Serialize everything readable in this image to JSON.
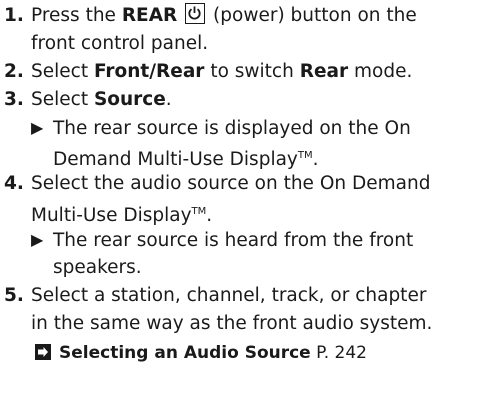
{
  "steps": [
    {
      "num": "1.",
      "a": "Press the ",
      "b": "REAR",
      "c": "(power) button on the",
      "d": "front control panel."
    },
    {
      "num": "2.",
      "a": "Select ",
      "b": "Front",
      "c": "/",
      "d": "Rear",
      "e": " to switch ",
      "f": "Rear",
      "g": " mode."
    },
    {
      "num": "3.",
      "a": "Select ",
      "b": "Source",
      "c": ".",
      "result1": "The rear source is displayed on the On",
      "result2": "Demand Multi-Use Display",
      "tm": "TM",
      "result2_end": "."
    },
    {
      "num": "4.",
      "a": "Select the audio source on the On Demand",
      "b": "Multi-Use Display",
      "tm": "TM",
      "c": ".",
      "result1": "The rear source is heard from the front",
      "result2": "speakers."
    },
    {
      "num": "5.",
      "a": "Select a station, channel, track, or chapter",
      "b": "in the same way as the front audio system."
    }
  ],
  "reference": {
    "title": "Selecting an Audio Source",
    "page": "P. 242"
  },
  "icons": {
    "power": "power-icon",
    "arrow": "right-triangle-icon",
    "ref": "reference-arrow-icon"
  }
}
